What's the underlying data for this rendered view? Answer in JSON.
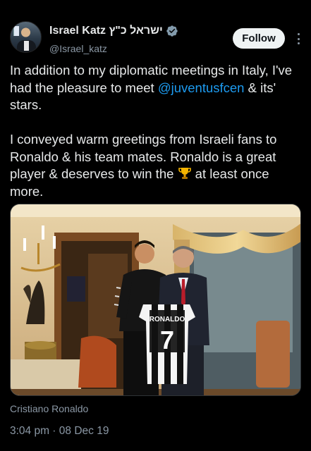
{
  "author": {
    "display_name": "Israel Katz ישראל כ\"ץ",
    "handle": "@Israel_katz",
    "verified": true,
    "avatar_icon": "profile-photo"
  },
  "actions": {
    "follow_label": "Follow",
    "more_icon": "more-vertical-icon"
  },
  "tweet": {
    "p1_before": "In addition to my diplomatic meetings in Italy, I've had the pleasure to meet ",
    "p1_mention": "@juventusfcen",
    "p1_after": " & its' stars.",
    "p2_before": "I conveyed warm greetings from Israeli fans to Ronaldo & his team mates. Ronaldo is a great player & deserves to win the ",
    "p2_emoji": "trophy-icon",
    "p2_after": " at least once more."
  },
  "media": {
    "jersey_name": "RONALDO",
    "jersey_number": "7"
  },
  "media_caption": "Cristiano Ronaldo",
  "timestamp": "3:04 pm · 08 Dec 19",
  "colors": {
    "background": "#000000",
    "text": "#e7e9ea",
    "secondary": "#8b98a5",
    "link": "#1d9bf0",
    "verified": "#829aab",
    "follow_bg": "#eff3f4"
  }
}
